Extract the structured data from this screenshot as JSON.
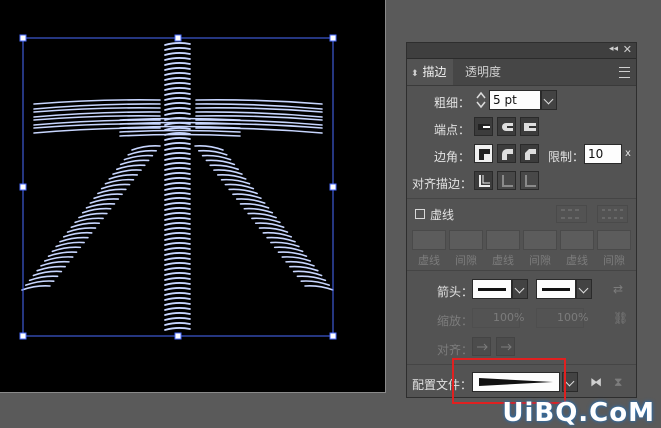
{
  "panel": {
    "tabs": [
      {
        "label": "描边",
        "active": true
      },
      {
        "label": "透明度",
        "active": false
      }
    ],
    "weight": {
      "label": "粗细：",
      "value": "5 pt"
    },
    "cap": {
      "label": "端点："
    },
    "corner": {
      "label": "边角：",
      "limit_label": "限制：",
      "limit_value": "10",
      "limit_unit": "x"
    },
    "align": {
      "label": "对齐描边："
    },
    "dashed": {
      "label": "虚线",
      "checked": false,
      "cells": [
        "虚线",
        "间隙",
        "虚线",
        "间隙",
        "虚线",
        "间隙"
      ]
    },
    "arrows": {
      "label": "箭头："
    },
    "scale": {
      "label": "缩放：",
      "start": "100%",
      "end": "100%"
    },
    "alignment": {
      "label": "对齐："
    },
    "profile": {
      "label": "配置文件："
    }
  },
  "watermark": "UiBQ.CoM",
  "colors": {
    "accent_highlight": "#e02020",
    "art_stroke": "#c8d6ff",
    "selection": "#4a6cff"
  }
}
